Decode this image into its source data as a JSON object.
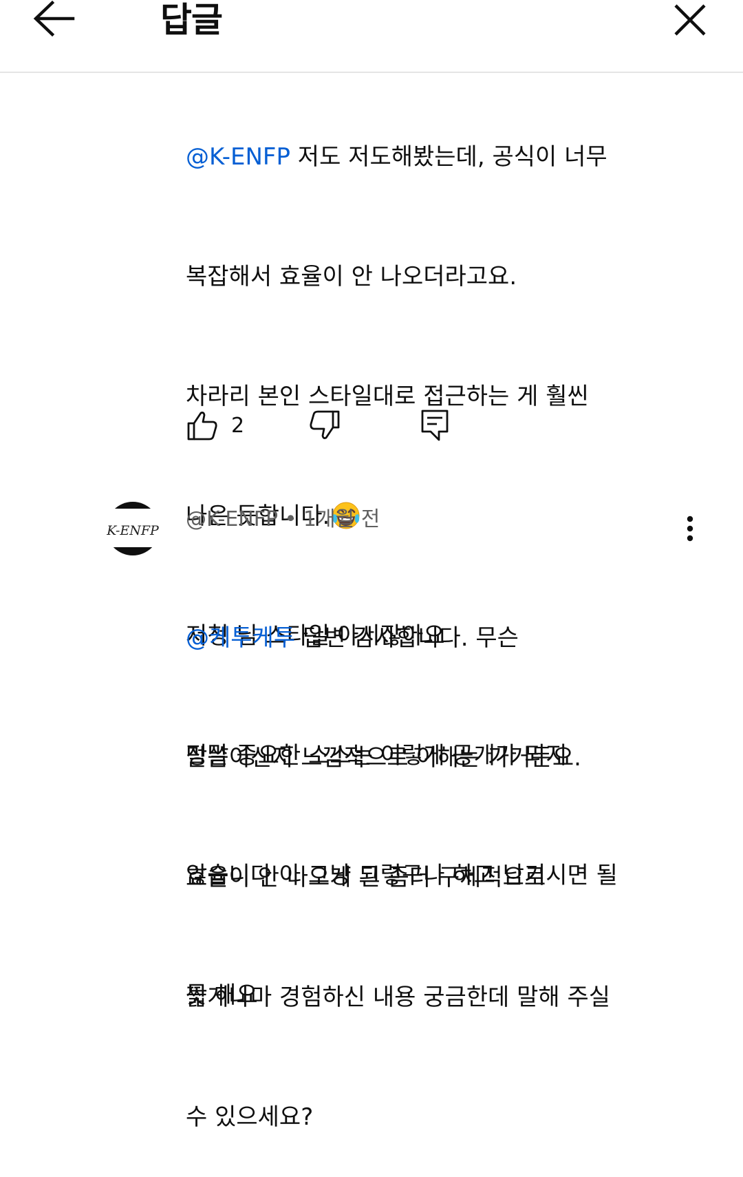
{
  "header": {
    "title": "답글",
    "back_icon": "arrow-left-icon",
    "close_icon": "close-icon"
  },
  "comment_1": {
    "partial_line": {
      "mention": "@K-ENFP",
      "text": " 저도 저도해봤는데, 공식이 너무"
    },
    "lines": [
      "복잡해서 효율이 안 나오더라고요.",
      "차라리 본인 스타일대로 접근하는 게 훨씬",
      "나은 듯합니다.",
      "저청 님 스타일 아시잖아요",
      "정말 중요한 소스는 이렇게 공개가 되지",
      "않습니다 아 그냥 그렇구나 하고 남기시면 될",
      "듯 해요"
    ],
    "emoji": "tears-of-joy-emoji",
    "like_count": "2",
    "icons": {
      "like": "thumbs-up-icon",
      "dislike": "thumbs-down-icon",
      "reply": "reply-icon"
    }
  },
  "comment_2": {
    "avatar_text": "K-ENFP",
    "author": "@K-ENFP",
    "separator": " • ",
    "time": "1개월 전",
    "mention": "@케투케투",
    "first_line_text": " 답변 감사합니다. 무슨",
    "lines": [
      "말씀이신지 느낌적으로 이해는 가거든요.",
      "효율이 안 나오게 된 좀더 구체적으로",
      "짧게나마 경험하신 내용 궁금한데 말해 주실",
      "수 있으세요?"
    ],
    "more_icon": "more-vertical-icon"
  },
  "colors": {
    "mention": "#065fd4",
    "meta_text": "#606060",
    "text": "#0f0f0f",
    "divider": "#e5e5e5"
  }
}
